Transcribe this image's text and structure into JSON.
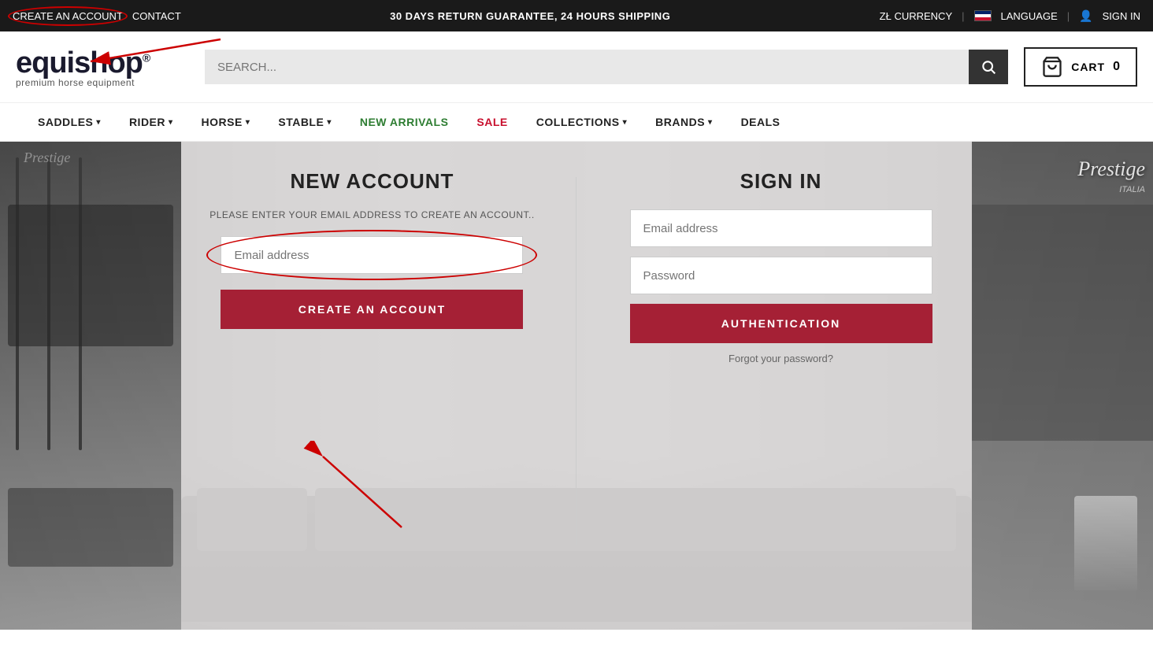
{
  "topbar": {
    "create_account": "CREATE AN ACCOUNT",
    "contact": "CONTACT",
    "promo": "30 DAYS RETURN GUARANTEE, 24 HOURS SHIPPING",
    "currency_label": "ZŁ  CURRENCY",
    "language_label": "LANGUAGE",
    "sign_in": "SIGN IN"
  },
  "header": {
    "logo_brand": "equishop",
    "logo_tagline": "premium horse equipment",
    "search_placeholder": "SEARCH...",
    "cart_label": "CART",
    "cart_count": "0"
  },
  "nav": {
    "items": [
      {
        "label": "SADDLES",
        "has_dropdown": true
      },
      {
        "label": "RIDER",
        "has_dropdown": true
      },
      {
        "label": "HORSE",
        "has_dropdown": true
      },
      {
        "label": "STABLE",
        "has_dropdown": true
      },
      {
        "label": "NEW ARRIVALS",
        "has_dropdown": false,
        "class": "new-arrivals"
      },
      {
        "label": "SALE",
        "has_dropdown": false,
        "class": "sale"
      },
      {
        "label": "COLLECTIONS",
        "has_dropdown": true
      },
      {
        "label": "BRANDS",
        "has_dropdown": true
      },
      {
        "label": "DEALS",
        "has_dropdown": false
      }
    ]
  },
  "new_account": {
    "title": "NEW ACCOUNT",
    "subtitle": "PLEASE ENTER YOUR EMAIL ADDRESS TO CREATE AN ACCOUNT..",
    "email_placeholder": "Email address",
    "button_label": "CREATE AN ACCOUNT"
  },
  "sign_in": {
    "title": "SIGN IN",
    "email_placeholder": "Email address",
    "password_placeholder": "Password",
    "button_label": "AUTHENTICATION",
    "forgot_label": "Forgot your password?"
  }
}
